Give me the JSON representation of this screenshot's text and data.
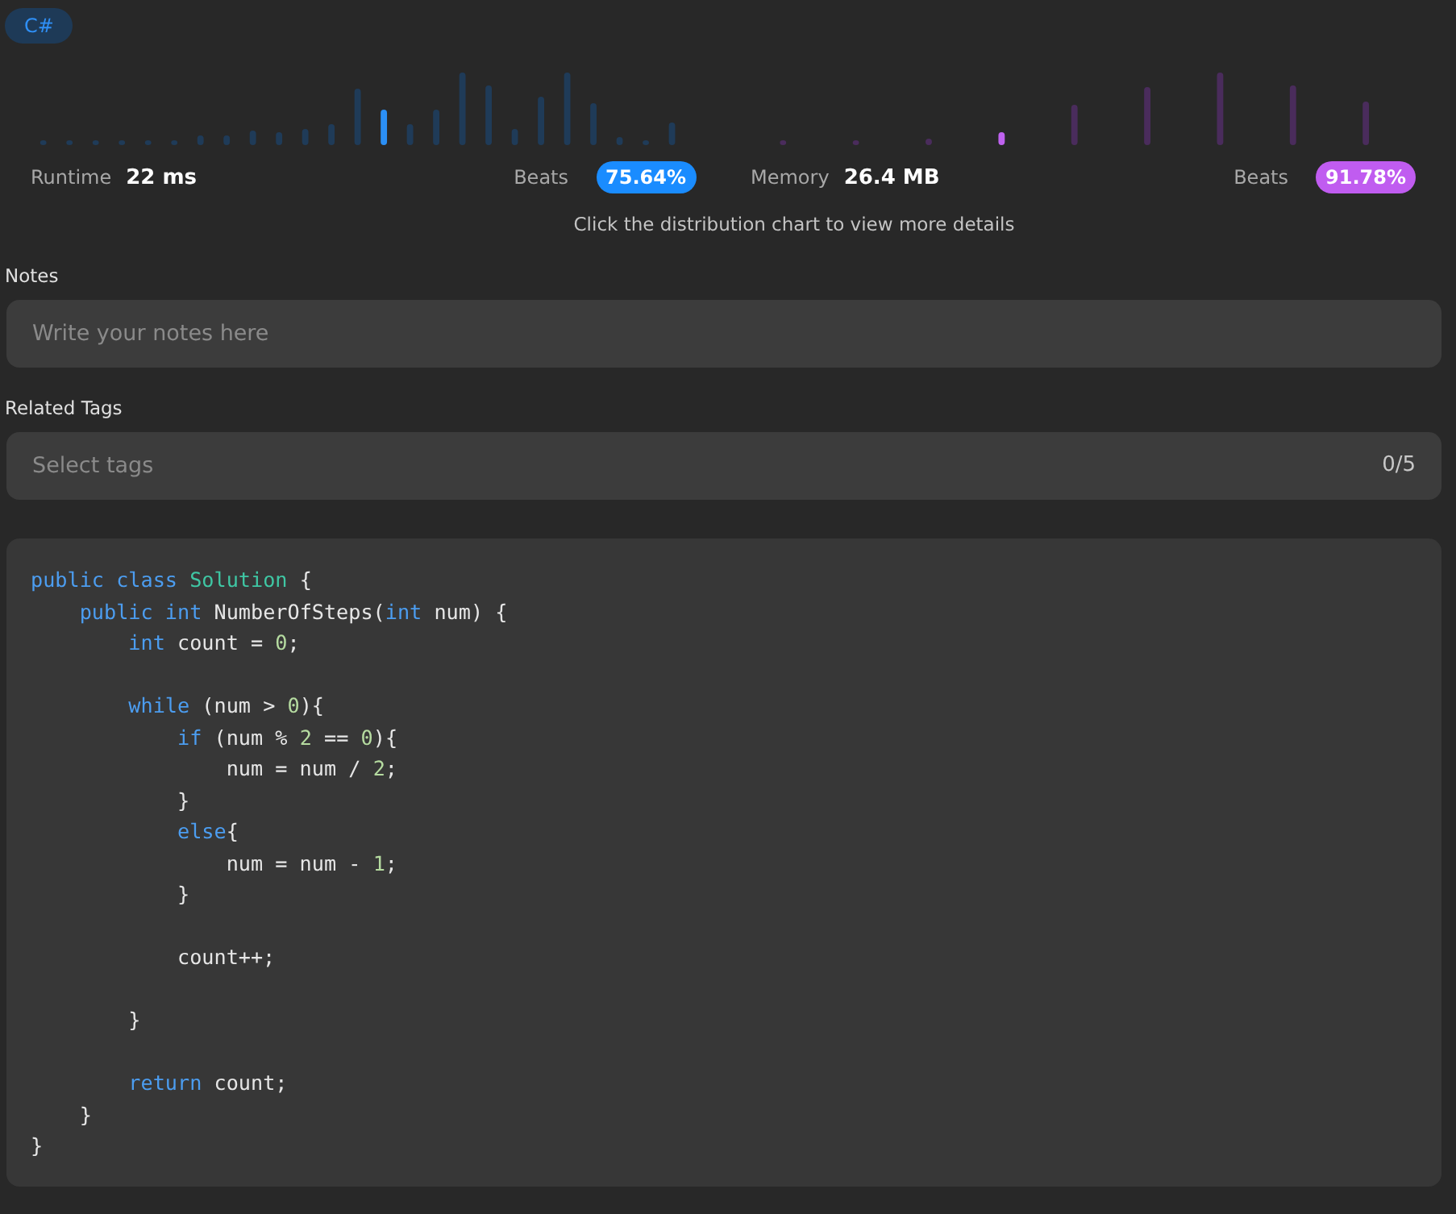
{
  "language_tag": "C#",
  "runtime": {
    "label": "Runtime",
    "value": "22 ms",
    "beats_label": "Beats",
    "beats": "75.64%"
  },
  "memory": {
    "label": "Memory",
    "value": "26.4 MB",
    "beats_label": "Beats",
    "beats": "91.78%"
  },
  "chart_hint": "Click the distribution chart to view more details",
  "notes": {
    "label": "Notes",
    "placeholder": "Write your notes here"
  },
  "related_tags": {
    "label": "Related Tags",
    "placeholder": "Select tags",
    "count": "0/5"
  },
  "code_lines": [
    {
      "kind": "code",
      "tokens": [
        {
          "kind": "keyword",
          "text": "public class"
        },
        {
          "kind": "type",
          "text": " Solution"
        },
        {
          "kind": "plain",
          "text": " {"
        }
      ]
    },
    {
      "kind": "code",
      "tokens": [
        {
          "kind": "keyword",
          "text": "    public int"
        },
        {
          "kind": "plain",
          "text": " NumberOfSteps("
        },
        {
          "kind": "keyword",
          "text": "int"
        },
        {
          "kind": "plain",
          "text": " num) {"
        }
      ]
    },
    {
      "kind": "code",
      "tokens": [
        {
          "kind": "keyword",
          "text": "        int"
        },
        {
          "kind": "plain",
          "text": " count = "
        },
        {
          "kind": "number",
          "text": "0"
        },
        {
          "kind": "plain",
          "text": ";"
        }
      ]
    },
    {
      "kind": "blank"
    },
    {
      "kind": "code",
      "tokens": [
        {
          "kind": "keyword",
          "text": "        while"
        },
        {
          "kind": "plain",
          "text": " (num > "
        },
        {
          "kind": "number",
          "text": "0"
        },
        {
          "kind": "plain",
          "text": "){"
        }
      ]
    },
    {
      "kind": "code",
      "tokens": [
        {
          "kind": "keyword",
          "text": "            if"
        },
        {
          "kind": "plain",
          "text": " (num % "
        },
        {
          "kind": "number",
          "text": "2"
        },
        {
          "kind": "plain",
          "text": " == "
        },
        {
          "kind": "number",
          "text": "0"
        },
        {
          "kind": "plain",
          "text": "){"
        }
      ]
    },
    {
      "kind": "code",
      "tokens": [
        {
          "kind": "plain",
          "text": "                num = num / "
        },
        {
          "kind": "number",
          "text": "2"
        },
        {
          "kind": "plain",
          "text": ";"
        }
      ]
    },
    {
      "kind": "code",
      "tokens": [
        {
          "kind": "plain",
          "text": "            }"
        }
      ]
    },
    {
      "kind": "code",
      "tokens": [
        {
          "kind": "keyword",
          "text": "            else"
        },
        {
          "kind": "plain",
          "text": "{"
        }
      ]
    },
    {
      "kind": "code",
      "tokens": [
        {
          "kind": "plain",
          "text": "                num = num - "
        },
        {
          "kind": "number",
          "text": "1"
        },
        {
          "kind": "plain",
          "text": ";"
        }
      ]
    },
    {
      "kind": "code",
      "tokens": [
        {
          "kind": "plain",
          "text": "            }"
        }
      ]
    },
    {
      "kind": "blank"
    },
    {
      "kind": "code",
      "tokens": [
        {
          "kind": "plain",
          "text": "            count++;"
        }
      ]
    },
    {
      "kind": "blank"
    },
    {
      "kind": "code",
      "tokens": [
        {
          "kind": "plain",
          "text": "        }"
        }
      ]
    },
    {
      "kind": "blank"
    },
    {
      "kind": "code",
      "tokens": [
        {
          "kind": "keyword",
          "text": "        return"
        },
        {
          "kind": "plain",
          "text": " count;"
        }
      ]
    },
    {
      "kind": "code",
      "tokens": [
        {
          "kind": "plain",
          "text": "    }"
        }
      ]
    },
    {
      "kind": "code",
      "tokens": [
        {
          "kind": "plain",
          "text": "}"
        }
      ]
    }
  ]
}
